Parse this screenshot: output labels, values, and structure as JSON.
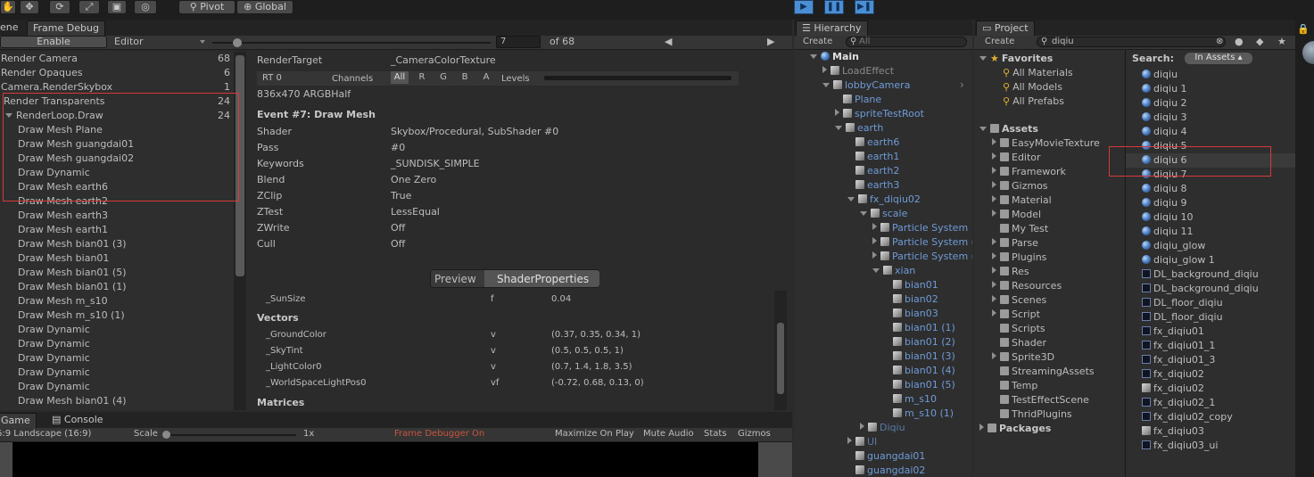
{
  "toolbar": {
    "pivot": "Pivot",
    "global": "Global"
  },
  "frame_debug": {
    "tab_scene": "ene",
    "tab_frame_debug": "Frame Debug",
    "enable": "Enable",
    "editor": "Editor",
    "frame": "7",
    "of": "of 68",
    "events": [
      {
        "label": "Render Camera",
        "count": "68",
        "indent": 0,
        "arrow": "r"
      },
      {
        "label": "Render Opaques",
        "count": "6",
        "indent": 0,
        "arrow": "r"
      },
      {
        "label": "Camera.RenderSkybox",
        "count": "1",
        "indent": 0,
        "arrow": "r"
      },
      {
        "label": "Render Transparents",
        "count": "24",
        "indent": 0,
        "arrow": "d"
      },
      {
        "label": "RenderLoop.Draw",
        "count": "24",
        "indent": 1,
        "arrow": "d"
      },
      {
        "label": "Draw Mesh Plane",
        "count": "",
        "indent": 2,
        "arrow": ""
      },
      {
        "label": "Draw Mesh guangdai01",
        "count": "",
        "indent": 2,
        "arrow": ""
      },
      {
        "label": "Draw Mesh guangdai02",
        "count": "",
        "indent": 2,
        "arrow": ""
      },
      {
        "label": "Draw Dynamic",
        "count": "",
        "indent": 2,
        "arrow": ""
      },
      {
        "label": "Draw Mesh earth6",
        "count": "",
        "indent": 2,
        "arrow": ""
      },
      {
        "label": "Draw Mesh earth2",
        "count": "",
        "indent": 2,
        "arrow": ""
      },
      {
        "label": "Draw Mesh earth3",
        "count": "",
        "indent": 2,
        "arrow": ""
      },
      {
        "label": "Draw Mesh earth1",
        "count": "",
        "indent": 2,
        "arrow": ""
      },
      {
        "label": "Draw Mesh bian01 (3)",
        "count": "",
        "indent": 2,
        "arrow": ""
      },
      {
        "label": "Draw Mesh bian01",
        "count": "",
        "indent": 2,
        "arrow": ""
      },
      {
        "label": "Draw Mesh bian01 (5)",
        "count": "",
        "indent": 2,
        "arrow": ""
      },
      {
        "label": "Draw Mesh bian01 (1)",
        "count": "",
        "indent": 2,
        "arrow": ""
      },
      {
        "label": "Draw Mesh m_s10",
        "count": "",
        "indent": 2,
        "arrow": ""
      },
      {
        "label": "Draw Mesh m_s10 (1)",
        "count": "",
        "indent": 2,
        "arrow": ""
      },
      {
        "label": "Draw Dynamic",
        "count": "",
        "indent": 2,
        "arrow": ""
      },
      {
        "label": "Draw Dynamic",
        "count": "",
        "indent": 2,
        "arrow": ""
      },
      {
        "label": "Draw Dynamic",
        "count": "",
        "indent": 2,
        "arrow": ""
      },
      {
        "label": "Draw Dynamic",
        "count": "",
        "indent": 2,
        "arrow": ""
      },
      {
        "label": "Draw Dynamic",
        "count": "",
        "indent": 2,
        "arrow": ""
      },
      {
        "label": "Draw Mesh bian01 (4)",
        "count": "",
        "indent": 2,
        "arrow": ""
      }
    ],
    "render_target_label": "RenderTarget",
    "render_target_value": "_CameraColorTexture",
    "rt": "RT 0",
    "channels": "Channels",
    "channel_buttons": [
      "All",
      "R",
      "G",
      "B",
      "A"
    ],
    "levels": "Levels",
    "resolution": "836x470 ARGBHalf",
    "event_title": "Event #7: Draw Mesh",
    "props": [
      {
        "k": "Shader",
        "v": "Skybox/Procedural, SubShader #0"
      },
      {
        "k": "Pass",
        "v": "#0"
      },
      {
        "k": "Keywords",
        "v": "_SUNDISK_SIMPLE"
      },
      {
        "k": "Blend",
        "v": "One Zero"
      },
      {
        "k": "ZClip",
        "v": "True"
      },
      {
        "k": "ZTest",
        "v": "LessEqual"
      },
      {
        "k": "ZWrite",
        "v": "Off"
      },
      {
        "k": "Cull",
        "v": "Off"
      }
    ],
    "preview_tab": "Preview",
    "shader_props_tab": "ShaderProperties",
    "sunsize": {
      "name": "_SunSize",
      "type": "f",
      "value": "0.04"
    },
    "vectors_header": "Vectors",
    "vectors": [
      {
        "name": "_GroundColor",
        "type": "v",
        "value": "(0.37, 0.35, 0.34, 1)"
      },
      {
        "name": "_SkyTint",
        "type": "v",
        "value": "(0.5, 0.5, 0.5, 1)"
      },
      {
        "name": "_LightColor0",
        "type": "v",
        "value": "(0.7, 1.4, 1.8, 3.5)"
      },
      {
        "name": "_WorldSpaceLightPos0",
        "type": "vf",
        "value": "(-0.72, 0.68, 0.13, 0)"
      }
    ],
    "matrices_header": "Matrices"
  },
  "game": {
    "tab_game": "Game",
    "tab_console": "Console",
    "aspect": "6:9 Landscape (16:9)",
    "scale": "Scale",
    "scale_value": "1x",
    "status": "Frame Debugger On",
    "maximize": "Maximize On Play",
    "mute": "Mute Audio",
    "stats": "Stats",
    "gizmos": "Gizmos"
  },
  "hierarchy": {
    "tab": "Hierarchy",
    "create": "Create",
    "search_placeholder": "All",
    "items": [
      {
        "label": "Main",
        "indent": 0,
        "arrow": "d",
        "icon": "unity",
        "color": "white"
      },
      {
        "label": "LoadEffect",
        "indent": 1,
        "arrow": "r",
        "icon": "cube",
        "color": "dim"
      },
      {
        "label": "lobbyCamera",
        "indent": 1,
        "arrow": "d",
        "icon": "cube",
        "color": "blue"
      },
      {
        "label": "Plane",
        "indent": 2,
        "arrow": "",
        "icon": "cube",
        "color": "blue"
      },
      {
        "label": "spriteTestRoot",
        "indent": 2,
        "arrow": "r",
        "icon": "cube",
        "color": "blue"
      },
      {
        "label": "earth",
        "indent": 2,
        "arrow": "d",
        "icon": "cube",
        "color": "blue"
      },
      {
        "label": "earth6",
        "indent": 3,
        "arrow": "",
        "icon": "cube",
        "color": "blue"
      },
      {
        "label": "earth1",
        "indent": 3,
        "arrow": "",
        "icon": "cube",
        "color": "blue"
      },
      {
        "label": "earth2",
        "indent": 3,
        "arrow": "",
        "icon": "cube",
        "color": "blue"
      },
      {
        "label": "earth3",
        "indent": 3,
        "arrow": "",
        "icon": "cube",
        "color": "blue"
      },
      {
        "label": "fx_diqiu02",
        "indent": 3,
        "arrow": "d",
        "icon": "cube",
        "color": "blue"
      },
      {
        "label": "scale",
        "indent": 4,
        "arrow": "d",
        "icon": "cube",
        "color": "blue"
      },
      {
        "label": "Particle System",
        "indent": 5,
        "arrow": "r",
        "icon": "cube",
        "color": "blue"
      },
      {
        "label": "Particle System (",
        "indent": 5,
        "arrow": "r",
        "icon": "cube",
        "color": "blue"
      },
      {
        "label": "Particle System (",
        "indent": 5,
        "arrow": "r",
        "icon": "cube",
        "color": "blue"
      },
      {
        "label": "xian",
        "indent": 5,
        "arrow": "d",
        "icon": "cube",
        "color": "blue"
      },
      {
        "label": "bian01",
        "indent": 6,
        "arrow": "",
        "icon": "cube",
        "color": "blue"
      },
      {
        "label": "bian02",
        "indent": 6,
        "arrow": "",
        "icon": "cube",
        "color": "blue"
      },
      {
        "label": "bian03",
        "indent": 6,
        "arrow": "",
        "icon": "cube",
        "color": "blue"
      },
      {
        "label": "bian01 (1)",
        "indent": 6,
        "arrow": "",
        "icon": "cube",
        "color": "blue"
      },
      {
        "label": "bian01 (2)",
        "indent": 6,
        "arrow": "",
        "icon": "cube",
        "color": "blue"
      },
      {
        "label": "bian01 (3)",
        "indent": 6,
        "arrow": "",
        "icon": "cube",
        "color": "blue"
      },
      {
        "label": "bian01 (4)",
        "indent": 6,
        "arrow": "",
        "icon": "cube",
        "color": "blue"
      },
      {
        "label": "bian01 (5)",
        "indent": 6,
        "arrow": "",
        "icon": "cube",
        "color": "blue"
      },
      {
        "label": "m_s10",
        "indent": 6,
        "arrow": "",
        "icon": "cube",
        "color": "blue"
      },
      {
        "label": "m_s10 (1)",
        "indent": 6,
        "arrow": "",
        "icon": "cube",
        "color": "blue"
      },
      {
        "label": "Diqiu",
        "indent": 4,
        "arrow": "r",
        "icon": "cube",
        "color": "dimblue"
      },
      {
        "label": "UI",
        "indent": 3,
        "arrow": "r",
        "icon": "cube",
        "color": "dimblue"
      },
      {
        "label": "guangdai01",
        "indent": 3,
        "arrow": "",
        "icon": "cube",
        "color": "blue"
      },
      {
        "label": "guangdai02",
        "indent": 3,
        "arrow": "",
        "icon": "cube",
        "color": "blue"
      }
    ]
  },
  "project": {
    "tab": "Project",
    "create": "Create",
    "search_value": "diqiu",
    "favorites_header": "Favorites",
    "favorites": [
      "All Materials",
      "All Models",
      "All Prefabs"
    ],
    "assets_header": "Assets",
    "folders": [
      "EasyMovieTexture",
      "Editor",
      "Framework",
      "Gizmos",
      "Material",
      "Model",
      "My Test",
      "Parse",
      "Plugins",
      "Res",
      "Resources",
      "Scenes",
      "Script",
      "Scripts",
      "Shader",
      "Sprite3D",
      "StreamingAssets",
      "Temp",
      "TestEffectScene",
      "ThridPlugins"
    ],
    "folder_arrows": [
      "r",
      "r",
      "r",
      "r",
      "r",
      "r",
      "",
      "r",
      "r",
      "r",
      "r",
      "r",
      "r",
      "",
      "",
      "r",
      "",
      "",
      "",
      ""
    ],
    "packages_header": "Packages",
    "search_label": "Search:",
    "scope": "In Assets",
    "results": [
      {
        "label": "diqiu",
        "icon": "sphere"
      },
      {
        "label": "diqiu 1",
        "icon": "sphere"
      },
      {
        "label": "diqiu 2",
        "icon": "sphere"
      },
      {
        "label": "diqiu 3",
        "icon": "sphere"
      },
      {
        "label": "diqiu 4",
        "icon": "sphere"
      },
      {
        "label": "diqiu 5",
        "icon": "sphere"
      },
      {
        "label": "diqiu 6",
        "icon": "sphere"
      },
      {
        "label": "diqiu 7",
        "icon": "sphere"
      },
      {
        "label": "diqiu 8",
        "icon": "sphere"
      },
      {
        "label": "diqiu 9",
        "icon": "sphere"
      },
      {
        "label": "diqiu 10",
        "icon": "sphere"
      },
      {
        "label": "diqiu 11",
        "icon": "sphere"
      },
      {
        "label": "diqiu_glow",
        "icon": "sphere"
      },
      {
        "label": "diqiu_glow 1",
        "icon": "sphere"
      },
      {
        "label": "DL_background_diqiu",
        "icon": "tex"
      },
      {
        "label": "DL_background_diqiu",
        "icon": "tex"
      },
      {
        "label": "DL_floor_diqiu",
        "icon": "tex"
      },
      {
        "label": "DL_floor_diqiu",
        "icon": "tex"
      },
      {
        "label": "fx_diqiu01",
        "icon": "tex"
      },
      {
        "label": "fx_diqiu01_1",
        "icon": "tex"
      },
      {
        "label": "fx_diqiu01_3",
        "icon": "tex"
      },
      {
        "label": "fx_diqiu02",
        "icon": "tex"
      },
      {
        "label": "fx_diqiu02",
        "icon": "cube"
      },
      {
        "label": "fx_diqiu02_1",
        "icon": "tex"
      },
      {
        "label": "fx_diqiu02_copy",
        "icon": "tex"
      },
      {
        "label": "fx_diqiu03",
        "icon": "cube"
      },
      {
        "label": "fx_diqiu03_ui",
        "icon": "tex"
      }
    ]
  }
}
